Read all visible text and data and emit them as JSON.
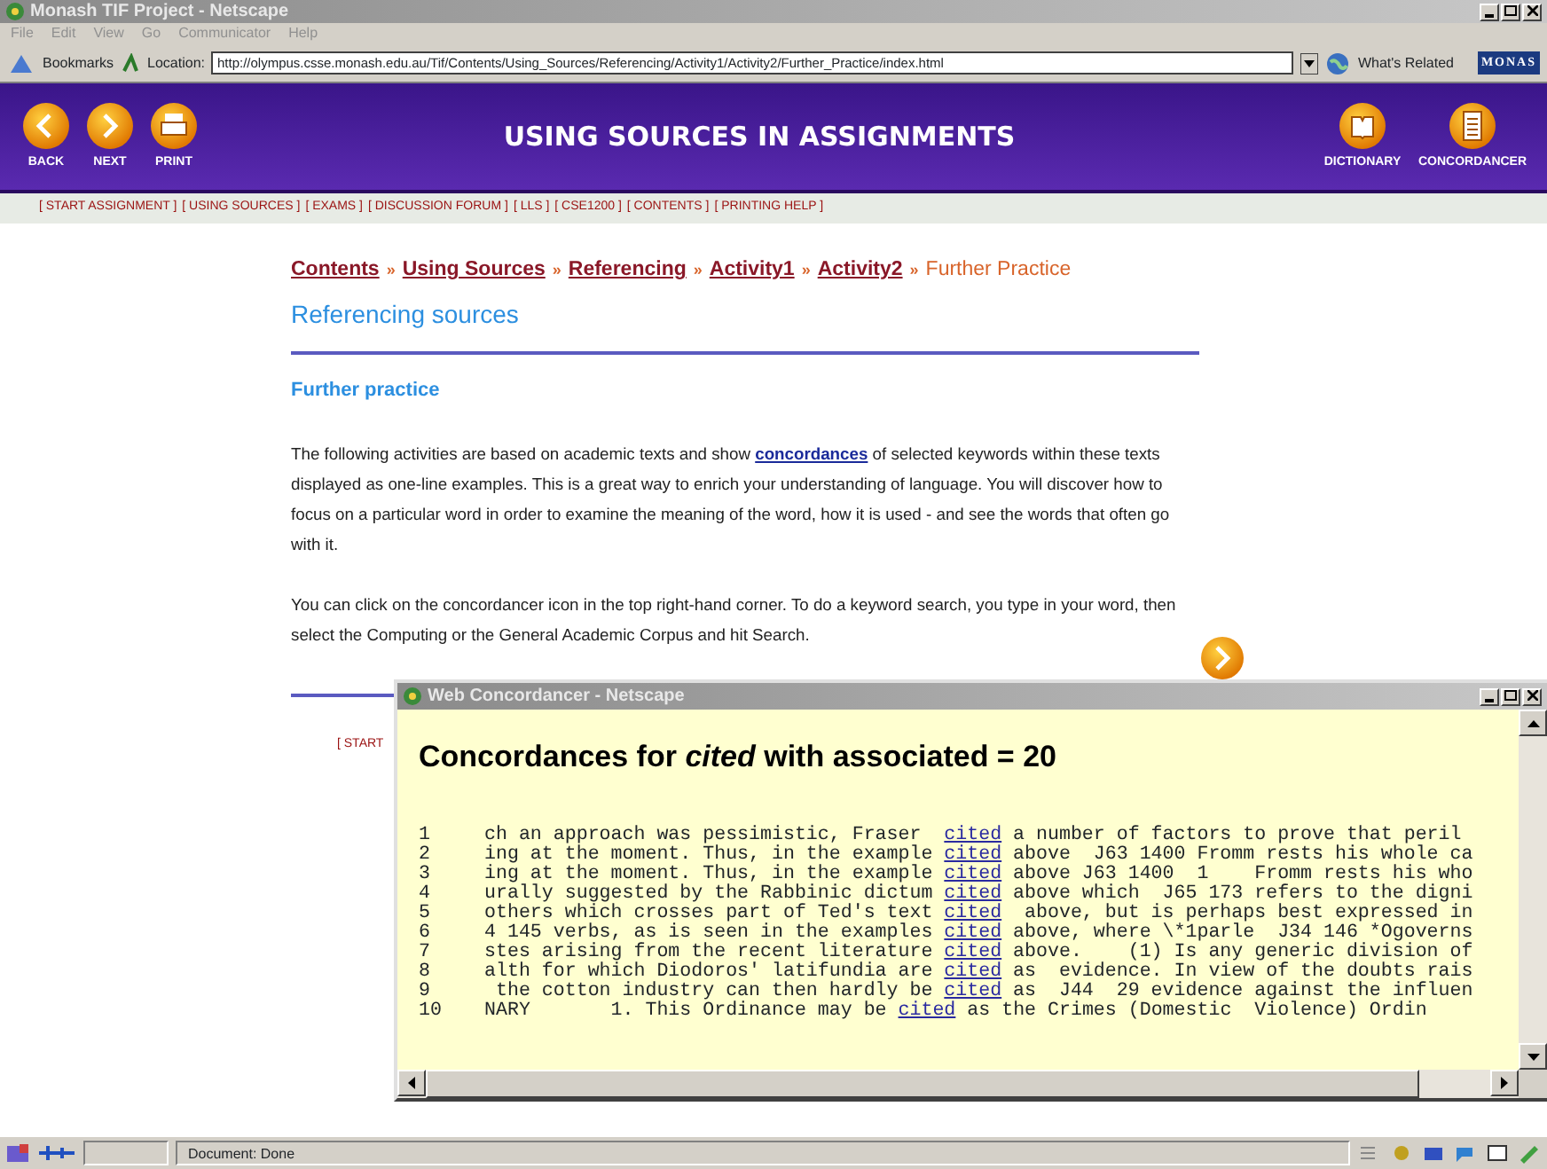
{
  "browser": {
    "title": "Monash TIF Project - Netscape",
    "menu": [
      "File",
      "Edit",
      "View",
      "Go",
      "Communicator",
      "Help"
    ],
    "bookmarks": "Bookmarks",
    "location_label": "Location:",
    "url": "http://olympus.csse.monash.edu.au/Tif/Contents/Using_Sources/Referencing/Activity1/Activity2/Further_Practice/index.html",
    "whats_related": "What's Related",
    "logo": "MONAS"
  },
  "header": {
    "title": "USING SOURCES IN ASSIGNMENTS",
    "left_buttons": [
      {
        "label": "BACK",
        "kind": "back"
      },
      {
        "label": "NEXT",
        "kind": "next"
      },
      {
        "label": "PRINT",
        "kind": "print"
      }
    ],
    "right_buttons": [
      {
        "label": "DICTIONARY",
        "kind": "dictionary"
      },
      {
        "label": "CONCORDANCER",
        "kind": "concordancer"
      }
    ]
  },
  "nav_links": [
    "[ START ASSIGNMENT ]",
    "[ USING SOURCES ]",
    "[ EXAMS ]",
    "[ DISCUSSION FORUM ]",
    "[ LLS ]",
    "[ CSE1200 ]",
    "[ CONTENTS ]",
    "[ PRINTING HELP ]"
  ],
  "breadcrumb": [
    {
      "label": "Contents",
      "current": false
    },
    {
      "sep": "»",
      "label": "Using Sources",
      "current": false
    },
    {
      "sep": "»",
      "label": "Referencing",
      "current": false
    },
    {
      "sep": "»",
      "label": "Activity1",
      "current": false
    },
    {
      "sep": "»",
      "label": "Activity2",
      "current": false
    },
    {
      "sep": "»",
      "label": "Further Practice",
      "current": true
    }
  ],
  "heading": "Referencing sources",
  "subheading": "Further practice",
  "paragraphs": [
    {
      "before": "The following activities are based on academic texts and show ",
      "link": "concordances",
      "after": " of selected keywords within these texts displayed as one-line examples. This is a great way to enrich your understanding of language. You will discover how to focus on a particular word in order to examine the meaning of the word, how it is used - and see the words that often go with it."
    },
    {
      "before": "You can click on the concordancer icon in the top right-hand corner. To do a keyword search, you type in your word, then select the Computing or the General Academic Corpus and hit Search."
    }
  ],
  "footer_fragment": "[ START",
  "popup": {
    "title": "Web Concordancer - Netscape",
    "heading": "Concordances for *cited* with associated = 20",
    "lines": [
      {
        "number": "1",
        "left": "ch an approach was pessimistic, Fraser  ",
        "keyword": "cited",
        "right": " a number of factors to prove that peril"
      },
      {
        "number": "2",
        "left": "ing at the moment. Thus, in the example ",
        "keyword": "cited",
        "right": " above  J63 1400 Fromm rests his whole ca"
      },
      {
        "number": "3",
        "left": "ing at the moment. Thus, in the example ",
        "keyword": "cited",
        "right": " above J63 1400  1    Fromm rests his who"
      },
      {
        "number": "4",
        "left": "urally suggested by the Rabbinic dictum ",
        "keyword": "cited",
        "right": " above which  J65 173 refers to the digni"
      },
      {
        "number": "5",
        "left": "others which crosses part of Ted's text ",
        "keyword": "cited",
        "right": "  above, but is perhaps best expressed in"
      },
      {
        "number": "6",
        "left": "4 145 verbs, as is seen in the examples ",
        "keyword": "cited",
        "right": " above, where \\*1parle  J34 146 *Ogoverns"
      },
      {
        "number": "7",
        "left": "stes arising from the recent literature ",
        "keyword": "cited",
        "right": " above.    (1) Is any generic division of"
      },
      {
        "number": "8",
        "left": "alth for which Diodoros' latifundia are ",
        "keyword": "cited",
        "right": " as  evidence. In view of the doubts rais"
      },
      {
        "number": "9",
        "left": " the cotton industry can then hardly be ",
        "keyword": "cited",
        "right": " as  J44  29 evidence against the influen"
      },
      {
        "number": "10",
        "left": "NARY       1. This Ordinance may be ",
        "keyword": "cited",
        "right": " as the Crimes (Domestic  Violence) Ordin"
      }
    ]
  },
  "status_bar": {
    "text": "Document: Done"
  }
}
